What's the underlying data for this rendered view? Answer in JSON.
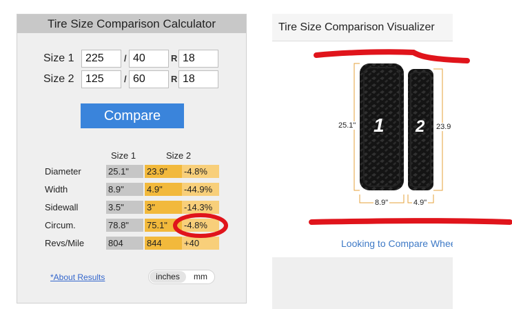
{
  "calculator": {
    "title": "Tire Size Comparison Calculator",
    "size1": {
      "label": "Size 1",
      "width": "225",
      "aspect": "40",
      "rim": "18"
    },
    "size2": {
      "label": "Size 2",
      "width": "125",
      "aspect": "60",
      "rim": "18"
    },
    "slash": "/",
    "rim_prefix": "R",
    "compare_label": "Compare",
    "columns": [
      "Size 1",
      "Size 2"
    ],
    "rows": [
      {
        "label": "Diameter",
        "size1": "25.1\"",
        "size2": "23.9\"",
        "diff": "-4.8%"
      },
      {
        "label": "Width",
        "size1": "8.9\"",
        "size2": "4.9\"",
        "diff": "-44.9%"
      },
      {
        "label": "Sidewall",
        "size1": "3.5\"",
        "size2": "3\"",
        "diff": "-14.3%"
      },
      {
        "label": "Circum.",
        "size1": "78.8\"",
        "size2": "75.1\"",
        "diff": "-4.8%"
      },
      {
        "label": "Revs/Mile",
        "size1": "804",
        "size2": "844",
        "diff": "+40"
      }
    ],
    "about_link": "*About Results",
    "units": {
      "inches": "inches",
      "mm": "mm",
      "selected": "inches"
    }
  },
  "visualizer": {
    "title": "Tire Size Comparison Visualizer",
    "tire1": {
      "number": "1",
      "diameter": "25.1\"",
      "width": "8.9\""
    },
    "tire2": {
      "number": "2",
      "diameter": "23.9",
      "width": "4.9\""
    },
    "link": "Looking to Compare Whee"
  },
  "colors": {
    "size1_cell": "#c6c6c6",
    "size2_cell": "#f2b93c",
    "diff_cell": "#f8cf7a",
    "button": "#3a84db",
    "annotation": "#e0141b"
  }
}
